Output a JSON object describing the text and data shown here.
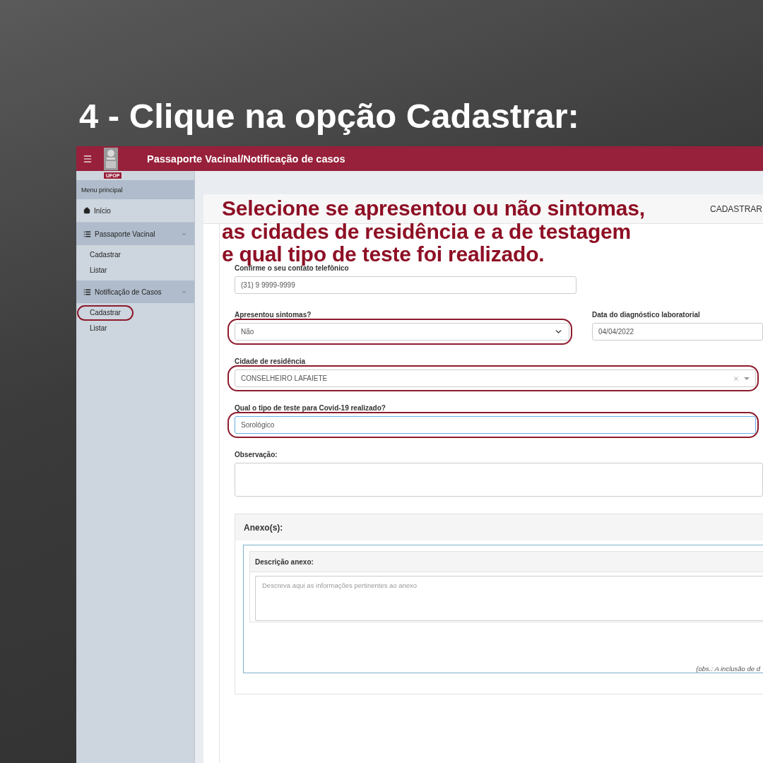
{
  "headline": "4 - Clique na opção Cadastrar:",
  "app": {
    "title": "Passaporte Vacinal/Notificação de casos",
    "logo_badge": "UFOP"
  },
  "sidebar": {
    "menu_title": "Menu principal",
    "items": [
      {
        "kind": "link",
        "label": "Início"
      },
      {
        "kind": "section",
        "label": "Passaporte Vacinal",
        "expanded": true,
        "children": [
          {
            "label": "Cadastrar",
            "highlighted": false
          },
          {
            "label": "Listar",
            "highlighted": false
          }
        ]
      },
      {
        "kind": "section",
        "label": "Notificação de Casos",
        "expanded": true,
        "children": [
          {
            "label": "Cadastrar",
            "highlighted": true
          },
          {
            "label": "Listar",
            "highlighted": false
          }
        ]
      }
    ]
  },
  "form": {
    "card_title": "CADASTRAR",
    "annotation": [
      "Selecione se apresentou ou não sintomas,",
      "as cidades de residência e a de testagem",
      "e qual tipo de teste foi realizado."
    ],
    "rows": [
      {
        "kind": "half",
        "fields": [
          {
            "kind": "text",
            "label": "Confirme o seu contato telefônico",
            "value": "(31) 9 9999-9999",
            "highlighted": false,
            "focused": false
          }
        ]
      },
      {
        "fields": [
          {
            "kind": "select",
            "label": "Apresentou sintomas?",
            "value": "Não",
            "highlighted": true,
            "focused": false
          },
          {
            "kind": "text",
            "label": "Data do diagnóstico laboratorial",
            "value": "04/04/2022",
            "highlighted": false,
            "focused": false
          }
        ]
      },
      {
        "fields": [
          {
            "kind": "combo",
            "label": "Cidade de residência",
            "value": "CONSELHEIRO LAFAIETE",
            "highlighted": true,
            "focused": false
          }
        ]
      },
      {
        "fields": [
          {
            "kind": "text",
            "label": "Qual o tipo de teste para Covid-19 realizado?",
            "value": "Sorológico",
            "highlighted": true,
            "focused": true
          }
        ]
      },
      {
        "fields": [
          {
            "kind": "textarea",
            "label": "Observação:",
            "highlighted": false,
            "focused": false
          }
        ]
      }
    ],
    "attachments": {
      "title": "Anexo(s):",
      "description_label": "Descrição anexo:",
      "description_placeholder": "Descreva aqui as informações pertinentes ao anexo",
      "note": "(obs.: A inclusão de d"
    }
  }
}
